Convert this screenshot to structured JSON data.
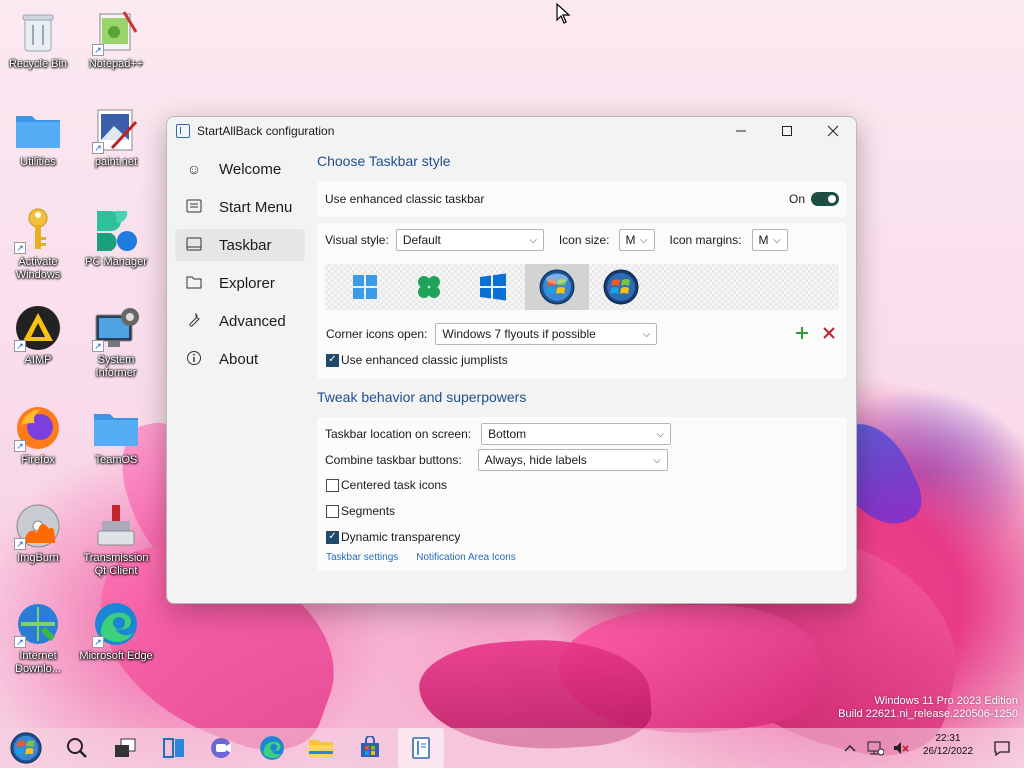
{
  "desktop": {
    "icons": [
      {
        "label": "Recycle Bin",
        "icon": "recycle-bin-icon"
      },
      {
        "label": "Notepad++",
        "icon": "notepadpp-icon"
      },
      {
        "label": "Utilities",
        "icon": "folder-icon"
      },
      {
        "label": "paint.net",
        "icon": "paintnet-icon"
      },
      {
        "label": "Activate Windows",
        "icon": "key-icon"
      },
      {
        "label": "PC Manager",
        "icon": "pc-manager-icon"
      },
      {
        "label": "AIMP",
        "icon": "aimp-icon"
      },
      {
        "label": "System Informer",
        "icon": "system-informer-icon"
      },
      {
        "label": "Firefox",
        "icon": "firefox-icon"
      },
      {
        "label": "TeamOS",
        "icon": "folder-icon"
      },
      {
        "label": "ImgBurn",
        "icon": "imgburn-icon"
      },
      {
        "label": "Transmission Qt Client",
        "icon": "transmission-icon"
      },
      {
        "label": "Internet Downlo...",
        "icon": "idm-icon"
      },
      {
        "label": "Microsoft Edge",
        "icon": "edge-icon"
      }
    ]
  },
  "window": {
    "title": "StartAllBack configuration",
    "nav": [
      {
        "label": "Welcome",
        "icon": "smile-icon"
      },
      {
        "label": "Start Menu",
        "icon": "start-menu-icon"
      },
      {
        "label": "Taskbar",
        "icon": "taskbar-icon",
        "active": true
      },
      {
        "label": "Explorer",
        "icon": "explorer-icon"
      },
      {
        "label": "Advanced",
        "icon": "wrench-icon"
      },
      {
        "label": "About",
        "icon": "info-icon"
      }
    ],
    "taskbar_style": {
      "section_title": "Choose Taskbar style",
      "enhanced_label": "Use enhanced classic taskbar",
      "toggle_state": "On",
      "visual_style_label": "Visual style:",
      "visual_style_value": "Default",
      "icon_size_label": "Icon size:",
      "icon_size_value": "M",
      "icon_margins_label": "Icon margins:",
      "icon_margins_value": "M",
      "styles": [
        "windows-11-icon",
        "clover-icon",
        "windows-10-icon",
        "windows-7-orb-icon",
        "windows-vista-orb-icon"
      ],
      "selected_style": 3,
      "corner_label": "Corner icons open:",
      "corner_value": "Windows 7 flyouts if possible",
      "jumplists_label": "Use enhanced classic jumplists",
      "jumplists_checked": true
    },
    "tweak": {
      "section_title": "Tweak behavior and superpowers",
      "location_label": "Taskbar location on screen:",
      "location_value": "Bottom",
      "combine_label": "Combine taskbar buttons:",
      "combine_value": "Always, hide labels",
      "centered_label": "Centered task icons",
      "centered_checked": false,
      "segments_label": "Segments",
      "segments_checked": false,
      "dynamic_label": "Dynamic transparency",
      "dynamic_checked": true,
      "link_taskbar_settings": "Taskbar settings",
      "link_notification": "Notification Area Icons"
    }
  },
  "watermark": {
    "line1": "Windows 11 Pro 2023 Edition",
    "line2": "Build 22621.ni_release.220506-1250"
  },
  "taskbar": {
    "apps": [
      "start-orb-icon",
      "search-icon",
      "task-view-icon",
      "widgets-icon",
      "teams-icon",
      "edge-icon",
      "file-explorer-icon",
      "store-icon",
      "startallback-icon"
    ],
    "clock_time": "22:31",
    "clock_date": "26/12/2022"
  },
  "colors": {
    "accent": "#1f4f8f",
    "link": "#2a6cb8",
    "toggle_on": "#1d4e42",
    "add": "#2e9a3a",
    "remove": "#b3282d"
  }
}
